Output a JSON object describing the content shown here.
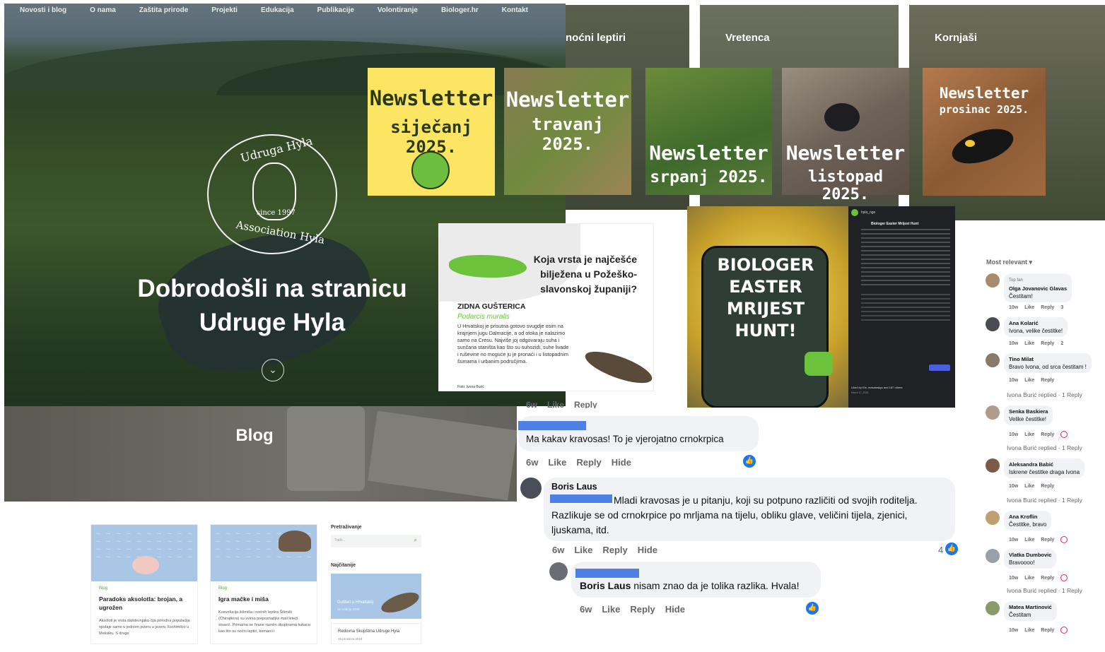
{
  "nav": [
    "Novosti i blog",
    "O nama",
    "Zaštita prirode",
    "Projekti",
    "Edukacija",
    "Publikacije",
    "Volontiranje",
    "Biologer.hr",
    "Kontakt"
  ],
  "logo": {
    "top": "Udruga Hyla",
    "bottom": "Association Hyla",
    "since": "since 1997"
  },
  "hero": {
    "welcome_line1": "Dobrodošli na stranicu",
    "welcome_line2": "Udruge Hyla",
    "scroll_icon": "chevron-down-icon"
  },
  "blog": {
    "banner_title": "Blog",
    "cards": [
      {
        "category": "Blog",
        "title": "Paradoks aksolotla: brojan, a ugrožen",
        "excerpt": "Aksolotl je vrsta daždevnjaka čija prirodna populacija opstaje samo u jednom jezeru u jezeru Xochimilco u Meksiku. S druge"
      },
      {
        "category": "Blog",
        "title": "Igra mačke i miša",
        "excerpt": "Koevolucija šišmiša i noćnih leptira Šišmiši (Chiroptera) su svima prepoznatljivi mali leteći sisavci. Primarna se hrane raznim skupinama kukaca kao što su noćni leptiri, komarci i"
      }
    ],
    "sidebar": {
      "search_label": "Pretraživanje",
      "search_placeholder": "Traži...",
      "latest_label": "Najčitanije",
      "latest_item1_title": "Gušteri u Hrvatskoj",
      "latest_item1_date": "15 svibnja 2025",
      "latest_item2_title": "Redovna Skupština Udruge Hyla",
      "latest_item2_date": "15 prosinca 2024"
    }
  },
  "species_headers": [
    "noćni leptiri",
    "Vretenca",
    "Kornjaši"
  ],
  "newsletters": [
    {
      "line1": "Newsletter",
      "line2": "siječanj 2025."
    },
    {
      "line1": "Newsletter",
      "line2": "travanj 2025."
    },
    {
      "line1": "Newsletter",
      "line2": "srpanj 2025."
    },
    {
      "line1": "Newsletter",
      "line2": "listopad 2025."
    },
    {
      "line1": "Newsletter",
      "line2": "prosinac 2025."
    }
  ],
  "lizard_post": {
    "question": "Koja vrsta je najčešće bilježena u Požeško-slavonskoj županiji?",
    "name": "ZIDNA GUŠTERICA",
    "latin": "Podarcis muralis",
    "text": "U Hrvatskoj je prisutna gotovo svugdje osim na krajnjem jugu Dalmacije, a od otoka je nalazimo samo na Cresu. Najviše joj odgovaraju suha i sunčana staništa kao što su suhozidi, suhe livade i ruševine no moguće ju je pronaći i u listopadnim šumama i urbanim područjima.",
    "credit": "Foto: Ivona Burić"
  },
  "easter_post": {
    "title": "BIOLOGER EASTER MRIJEST HUNT!",
    "account": "hyla_ngo",
    "caption_head": "Biologer Easter Mrijest Hunt",
    "likes": "Liked by Ele, masarasigo and 187 others",
    "date": "March 17, 2025"
  },
  "fb_comments": [
    {
      "text": "Ma kakav kravosas! To je vjerojatno crnokrpica",
      "meta": [
        "6w",
        "Like",
        "Reply",
        "Hide"
      ]
    },
    {
      "author": "Boris Laus",
      "text": "Mladi kravosas je u pitanju, koji su potpuno različiti od svojih roditelja. Razlikuje se od crnokrpice po mrljama na tijelu, obliku glave, veličini tijela, zjenici, ljuskama, itd.",
      "meta": [
        "6w",
        "Like",
        "Reply",
        "Hide"
      ],
      "reactions": "4"
    },
    {
      "mention": "Boris Laus",
      "text": " nisam znao da je tolika razlika. Hvala!",
      "meta": [
        "6w",
        "Like",
        "Reply",
        "Hide"
      ]
    }
  ],
  "top_cut_meta": [
    "6w",
    "Like",
    "Reply"
  ],
  "right_comments": {
    "sort_label": "Most relevant ▾",
    "items": [
      {
        "badge": "Top fan",
        "name": "Olga Jovanovic Glavas",
        "text": "Čestitam!",
        "time": "10w",
        "count": "3",
        "reply": ""
      },
      {
        "name": "Ana Kolarić",
        "text": "Ivona, velike čestitke!",
        "time": "10w",
        "count": "2",
        "reply": ""
      },
      {
        "name": "Tino Milat",
        "text": "Bravo Ivona, od srca čestitam !",
        "time": "10w",
        "count": "",
        "reply": "Ivona Burić replied · 1 Reply"
      },
      {
        "name": "Senka Baskiera",
        "text": "Velike čestitke!",
        "time": "10w",
        "count": "",
        "reply": "Ivona Burić replied · 1 Reply"
      },
      {
        "name": "Aleksandra Babić",
        "text": "Iskrene čestitke draga Ivona",
        "time": "10w",
        "count": "",
        "reply": "Ivona Burić replied · 1 Reply"
      },
      {
        "name": "Ana Kroflin",
        "text": "Čestitke, bravo",
        "time": "10w",
        "count": "",
        "reply": ""
      },
      {
        "name": "Vlatka Dumbovic",
        "text": "Bravoooo!",
        "time": "10w",
        "count": "",
        "reply": "Ivona Burić replied · 1 Reply"
      },
      {
        "name": "Matea Martinović",
        "text": "Čestitam",
        "time": "10w",
        "count": "",
        "reply": ""
      }
    ],
    "like_label": "Like",
    "reply_label": "Reply"
  }
}
